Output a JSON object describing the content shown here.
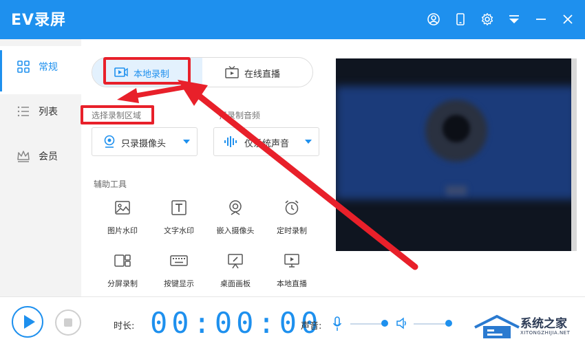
{
  "window": {
    "title": "EV录屏",
    "titlebar_icons": [
      "user-icon",
      "phone-icon",
      "gear-icon",
      "menu-icon",
      "minimize-icon",
      "close-icon"
    ]
  },
  "sidebar": {
    "items": [
      {
        "label": "常规",
        "icon": "grid-icon",
        "active": true
      },
      {
        "label": "列表",
        "icon": "list-icon",
        "active": false
      },
      {
        "label": "会员",
        "icon": "crown-icon",
        "active": false
      }
    ]
  },
  "mode_tabs": {
    "local": "本地录制",
    "live": "在线直播",
    "selected": "本地录制"
  },
  "region": {
    "label": "选择录制区域",
    "value": "只录摄像头"
  },
  "audio": {
    "label": "择录制音频",
    "value": "仅系统声音"
  },
  "tools": {
    "label": "辅助工具",
    "items": [
      {
        "label": "图片水印",
        "icon": "image-watermark-icon"
      },
      {
        "label": "文字水印",
        "icon": "text-watermark-icon"
      },
      {
        "label": "嵌入摄像头",
        "icon": "webcam-icon"
      },
      {
        "label": "定时录制",
        "icon": "alarm-clock-icon"
      },
      {
        "label": "分屏录制",
        "icon": "split-screen-icon"
      },
      {
        "label": "按键显示",
        "icon": "keyboard-icon"
      },
      {
        "label": "桌面画板",
        "icon": "drawing-board-icon"
      },
      {
        "label": "本地直播",
        "icon": "monitor-play-icon"
      }
    ]
  },
  "bottom": {
    "duration_label": "时长:",
    "timer": "00:00:00",
    "volume_label": "声音:",
    "mic_level": 0.96,
    "speaker_level": 0.98
  },
  "watermark": {
    "name": "系统之家",
    "url": "XITONGZHIJIA.NET"
  },
  "colors": {
    "accent": "#1e90ee",
    "highlight": "#e8202a",
    "sidebar_bg": "#f3f3f3"
  }
}
